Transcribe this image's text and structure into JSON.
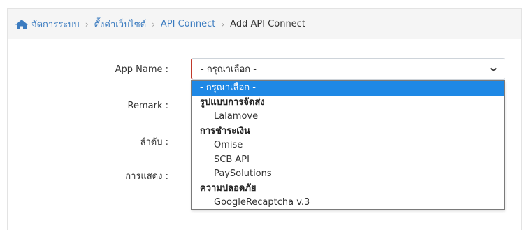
{
  "breadcrumb": {
    "items": [
      "จัดการระบบ",
      "ตั้งค่าเว็บไซต์",
      "API Connect"
    ],
    "current": "Add API Connect"
  },
  "form": {
    "app_name_label": "App Name :",
    "remark_label": "Remark :",
    "order_label": "ลำดับ :",
    "display_label": "การแสดง :",
    "app_name_value": "- กรุณาเลือก -"
  },
  "dropdown": {
    "placeholder": "- กรุณาเลือก -",
    "groups": [
      {
        "label": "รูปแบบการจัดส่ง",
        "options": [
          "Lalamove"
        ]
      },
      {
        "label": "การชำระเงิน",
        "options": [
          "Omise",
          "SCB API",
          "PaySolutions"
        ]
      },
      {
        "label": "ความปลอดภัย",
        "options": [
          "GoogleRecaptcha v.3"
        ]
      }
    ]
  },
  "colors": {
    "link": "#3c7cc0",
    "selected_option_bg": "#1e88e5",
    "required_border": "#c0392b"
  }
}
